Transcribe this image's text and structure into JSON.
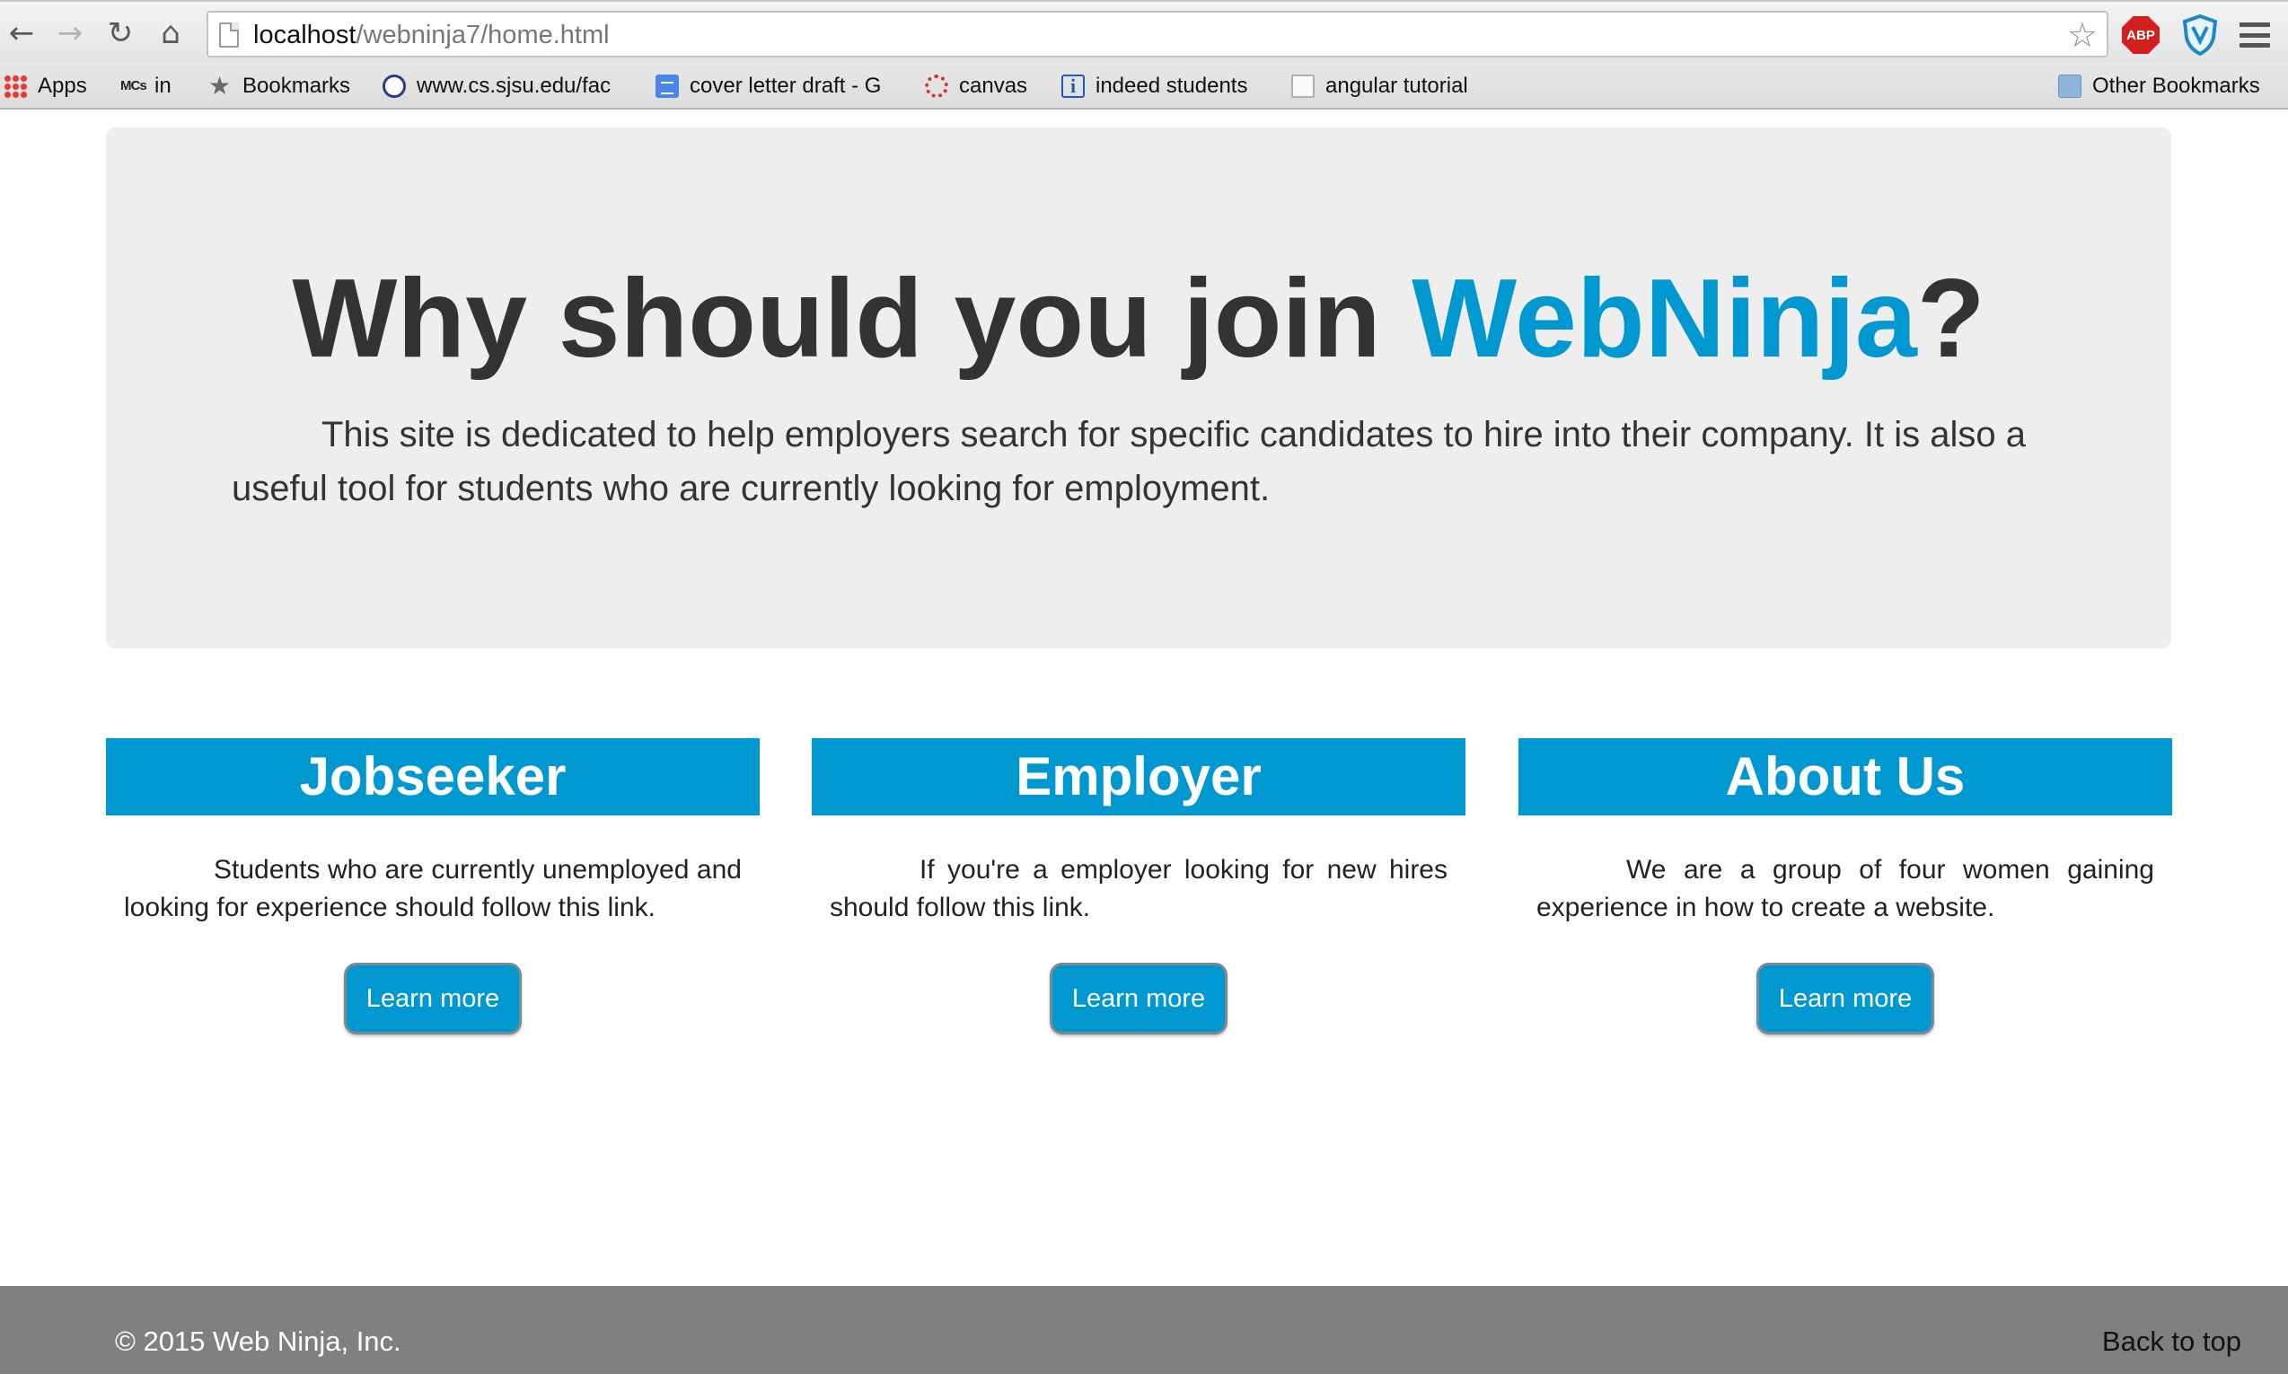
{
  "browser": {
    "url_host": "localhost",
    "url_path": "/webninja7/home.html",
    "bookmarks": [
      {
        "label": "Apps",
        "icon": "apps-grid-icon"
      },
      {
        "label": "in",
        "icon": "mcs-icon"
      },
      {
        "label": "Bookmarks",
        "icon": "star-icon"
      },
      {
        "label": "www.cs.sjsu.edu/fac",
        "icon": "globe-icon"
      },
      {
        "label": "cover letter draft - G",
        "icon": "google-doc-icon"
      },
      {
        "label": "canvas",
        "icon": "canvas-icon"
      },
      {
        "label": "indeed students",
        "icon": "info-icon"
      },
      {
        "label": "angular tutorial",
        "icon": "file-icon"
      }
    ],
    "other_bookmarks": "Other Bookmarks",
    "extension_abp": "ABP"
  },
  "hero": {
    "title_prefix": "Why should you join ",
    "title_brand": "WebNinja",
    "title_suffix": "?",
    "text": "This site is dedicated to help employers search for specific candidates to hire into their company. It is also a useful tool for students who are currently looking for employment."
  },
  "columns": [
    {
      "heading": "Jobseeker",
      "text": "Students who are currently unemployed and looking for experience should follow this link.",
      "button": "Learn more"
    },
    {
      "heading": "Employer",
      "text": "If you're a employer looking for new hires should follow this link.",
      "button": "Learn more"
    },
    {
      "heading": "About Us",
      "text": "We are a group of four women gaining experience in how to create a website.",
      "button": "Learn more"
    }
  ],
  "footer": {
    "copyright": "© 2015 Web Ninja, Inc.",
    "back_to_top": "Back to top"
  },
  "colors": {
    "brand": "#0098d0",
    "jumbotron_bg": "#eeeeee",
    "footer_bg": "#808080"
  }
}
